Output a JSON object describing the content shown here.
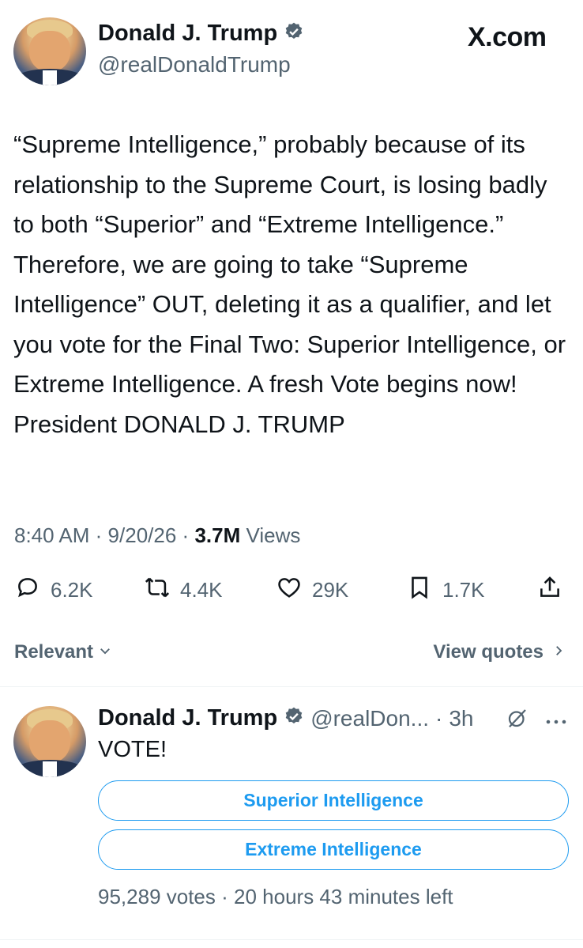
{
  "main_tweet": {
    "author_name": "Donald J. Trump",
    "handle": "@realDonaldTrump",
    "site_brand": "X.com",
    "text": "“Supreme Intelligence,” probably because of its relationship to the Supreme Court, is losing badly to both “Superior” and “Extreme Intelligence.” Therefore, we are going to take “Supreme Intelligence” OUT, deleting it as a qualifier, and let you vote for the Final Two: Superior Intelligence, or Extreme Intelligence. A fresh Vote begins now! President DONALD J. TRUMP",
    "time": "8:40 AM",
    "date": "9/20/26",
    "views_count": "3.7M",
    "views_label": "Views",
    "separator": "·",
    "actions": {
      "replies": "6.2K",
      "reposts": "4.4K",
      "likes": "29K",
      "bookmarks": "1.7K"
    }
  },
  "replies_bar": {
    "sort_label": "Relevant",
    "quotes_label": "View quotes"
  },
  "reply_tweet": {
    "author_name": "Donald J. Trump",
    "handle": "@realDon...",
    "separator": "·",
    "age": "3h",
    "text": "VOTE!",
    "poll": {
      "options": [
        "Superior Intelligence",
        "Extreme Intelligence"
      ],
      "votes": "95,289 votes",
      "time_left": "20 hours 43 minutes left"
    }
  },
  "colors": {
    "accent": "#1d9bf0",
    "text": "#0f1419",
    "muted": "#536471"
  },
  "icons": [
    "verified-badge-icon",
    "reply-icon",
    "repost-icon",
    "like-icon",
    "bookmark-icon",
    "share-icon",
    "chevron-down-icon",
    "chevron-right-icon",
    "grok-icon",
    "more-icon"
  ]
}
